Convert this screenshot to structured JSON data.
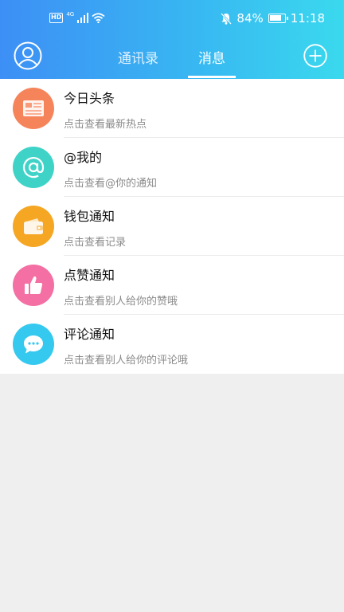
{
  "status_bar": {
    "hd": "HD",
    "network": "4G",
    "battery": "84%",
    "time": "11:18"
  },
  "header": {
    "tabs": [
      {
        "label": "通讯录",
        "active": false
      },
      {
        "label": "消息",
        "active": true
      }
    ],
    "accent_color": "#38b6f2"
  },
  "messages": [
    {
      "title": "今日头条",
      "subtitle": "点击查看最新热点",
      "icon": "newspaper-icon",
      "color": "#f6845a"
    },
    {
      "title": "@我的",
      "subtitle": "点击查看@你的通知",
      "icon": "at-sign-icon",
      "color": "#3fd3c8"
    },
    {
      "title": "钱包通知",
      "subtitle": "点击查看记录",
      "icon": "wallet-icon",
      "color": "#f5a623"
    },
    {
      "title": "点赞通知",
      "subtitle": "点击查看别人给你的赞哦",
      "icon": "thumbs-up-icon",
      "color": "#f46fa3"
    },
    {
      "title": "评论通知",
      "subtitle": "点击查看别人给你的评论哦",
      "icon": "comment-icon",
      "color": "#35c9f0"
    }
  ]
}
